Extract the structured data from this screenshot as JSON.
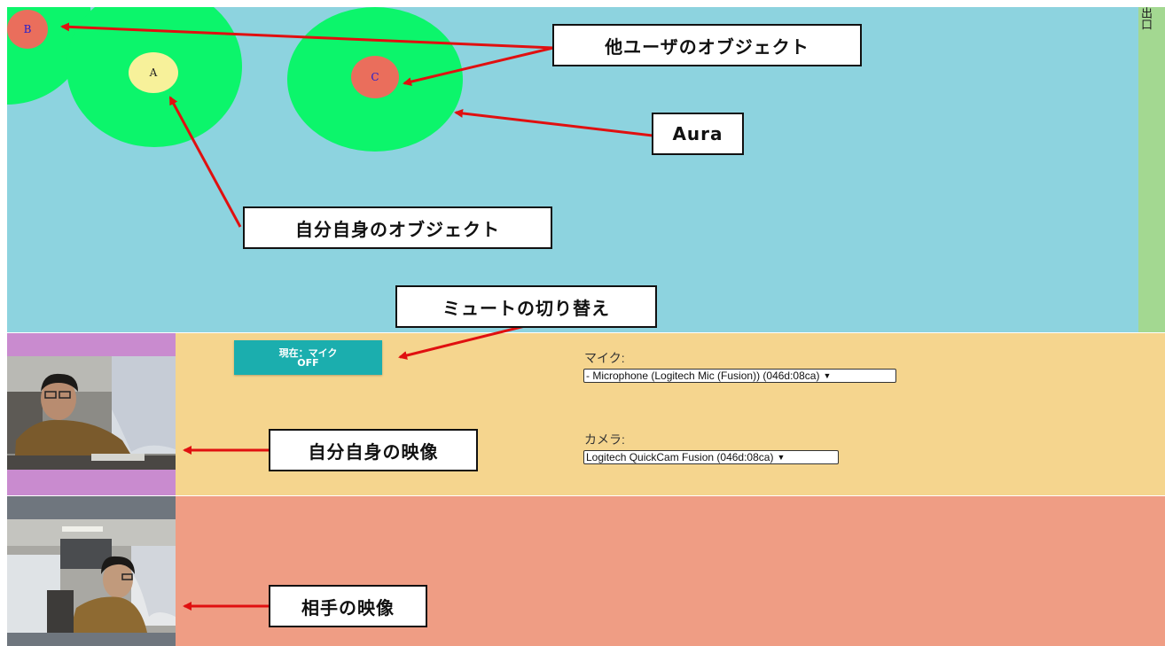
{
  "space": {
    "users": [
      {
        "id": "B",
        "label": "B",
        "color": "#ea6e5c",
        "text_color": "#1f1fd0"
      },
      {
        "id": "A",
        "label": "A",
        "color": "#f7f19a",
        "text_color": "#222222"
      },
      {
        "id": "C",
        "label": "C",
        "color": "#ea6e5c",
        "text_color": "#1f1fd0"
      }
    ],
    "aura_color": "#0cf56b",
    "background": "#8dd3df"
  },
  "exit": {
    "label": "出口"
  },
  "controls": {
    "mute_button": {
      "line1": "現在：マイク",
      "line2": "OFF"
    },
    "mic": {
      "label": "マイク:",
      "selected": "- Microphone (Logitech Mic (Fusion)) (046d:08ca)"
    },
    "camera": {
      "label": "カメラ:",
      "selected": "Logitech QuickCam Fusion (046d:08ca)"
    }
  },
  "annotations": {
    "other_users": "他ユーザのオブジェクト",
    "aura": "Aura",
    "self_object": "自分自身のオブジェクト",
    "mute_toggle": "ミュートの切り替え",
    "self_video": "自分自身の映像",
    "peer_video": "相手の映像"
  },
  "colors": {
    "self_panel": "#f5d58e",
    "peer_panel": "#ef9d84",
    "mute_button": "#1baeae",
    "arrow": "#e01010"
  }
}
